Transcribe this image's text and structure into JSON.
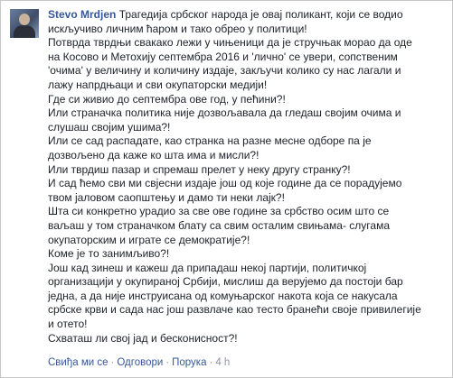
{
  "comment": {
    "author": "Stevo Mrdjen",
    "lines": [
      "Трагедија србског народа је овај поликант, који се водио",
      "искључиво личним ћаром и тако обрео у политици!",
      "Потврда тврдњи свакако лежи у чињеници да је стручњак морао да оде",
      "на Косово и Метохију септембра 2016 и 'лично' се увери, сопственим",
      "'очима' у величину и количину издаје, закључи колико су нас лагали и",
      "лажу напрдњаци и сви окупаторски медији!",
      "Где си живио до септембра ове год, у пећини?!",
      "Или страначка политика није дозвољавала да гледаш својим очима и",
      "слушаш својим ушима?!",
      "Или се сад распадате, као странка на разне месне одборе па је",
      "дозвољено да каже ко шта има и мисли?!",
      "Или тврдиш пазар и спремаш прелет у неку другу странку?!",
      "И сад ћемо сви ми свјесни издаје још од које године да се порадујемо",
      "твом јаловом саопштењу и дамо ти неки лајк?!",
      "Шта си конкретно урадио за све ове године за србство осим што се",
      "ваљаш у том страначком блату са свим осталим свињама- слугама",
      "окупаторским и играте се демократије?!",
      "Коме је то занимљиво?!",
      "Још кад зинеш и кажеш да припадаш некој партији, политичкој",
      "организацији у окупираној Србији, мислиш да верујемо да постоји бар",
      "једна, а да није инструисана од комуњарског накота која се накусала",
      "србске крви и сада нас још развлаче као тесто бранећи своје привилегије",
      "и отето!",
      "Схваташ ли свој јад и бесконисност?!"
    ]
  },
  "actions": {
    "like": "Свиђа ми се",
    "reply": "Одговори",
    "report": "Порука",
    "time": "4 h",
    "separator": "·"
  }
}
